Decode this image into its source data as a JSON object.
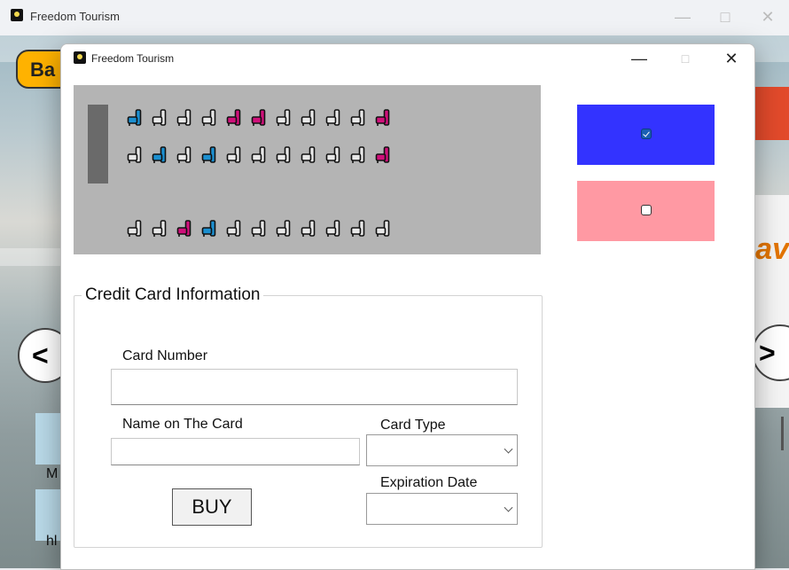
{
  "background_window": {
    "title": "Freedom Tourism",
    "controls": {
      "minimize": "—",
      "maximize": "□",
      "close": "✕"
    },
    "back_label": "Ba",
    "prev_label": "<",
    "next_label": ">",
    "bus_text": "av",
    "list_items": [
      "M",
      "hl"
    ]
  },
  "dialog": {
    "title": "Freedom Tourism",
    "controls": {
      "minimize": "—",
      "maximize": "□",
      "close": "✕"
    }
  },
  "seat_colors": {
    "available": "#e8e8e8",
    "selected_blue": "#1b8fd0",
    "taken_pink": "#d0107a"
  },
  "seat_rows": [
    [
      "blue",
      "empty",
      "empty",
      "empty",
      "pink",
      "pink",
      "empty",
      "empty",
      "empty",
      "empty",
      "pink"
    ],
    [
      "empty",
      "blue",
      "empty",
      "blue",
      "empty",
      "empty",
      "empty",
      "empty",
      "empty",
      "empty",
      "pink"
    ],
    [
      "empty",
      "empty",
      "pink",
      "blue",
      "empty",
      "empty",
      "empty",
      "empty",
      "empty",
      "empty",
      "empty"
    ]
  ],
  "legend": {
    "blue_color": "#3333ff",
    "pink_color": "#ff99a3",
    "blue_checked": true,
    "pink_checked": false
  },
  "credit_card": {
    "group_title": "Credit Card Information",
    "card_number_label": "Card Number",
    "card_number_value": "",
    "name_label": "Name on The Card",
    "name_value": "",
    "card_type_label": "Card Type",
    "card_type_value": "",
    "expiration_label": "Expiration Date",
    "expiration_value": "",
    "buy_label": "BUY"
  }
}
